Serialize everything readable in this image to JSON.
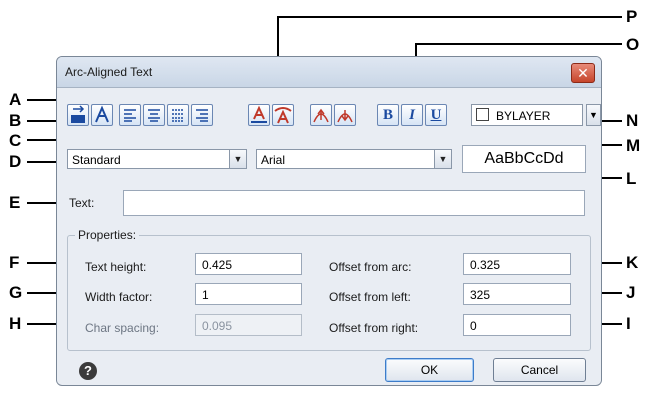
{
  "dialog": {
    "title": "Arc-Aligned Text",
    "close_glyph": "✕"
  },
  "toolbar": {
    "color_value": "BYLAYER"
  },
  "style_select": {
    "value": "Standard"
  },
  "font_select": {
    "value": "Arial"
  },
  "preview": {
    "text": "AaBbCcDd"
  },
  "text_field": {
    "label": "Text:",
    "value": ""
  },
  "properties": {
    "group_label": "Properties:",
    "text_height": {
      "label": "Text height:",
      "value": "0.425"
    },
    "width_factor": {
      "label": "Width factor:",
      "value": "1"
    },
    "char_spacing": {
      "label": "Char spacing:",
      "value": "0.095"
    },
    "offset_arc": {
      "label": "Offset from arc:",
      "value": "0.325"
    },
    "offset_left": {
      "label": "Offset from left:",
      "value": "325"
    },
    "offset_right": {
      "label": "Offset from right:",
      "value": "0"
    }
  },
  "buttons": {
    "help": "?",
    "ok": "OK",
    "cancel": "Cancel"
  },
  "callouts": {
    "A": "A",
    "B": "B",
    "C": "C",
    "D": "D",
    "E": "E",
    "F": "F",
    "G": "G",
    "H": "H",
    "I": "I",
    "J": "J",
    "K": "K",
    "L": "L",
    "M": "M",
    "N": "N",
    "O": "O",
    "P": "P"
  }
}
